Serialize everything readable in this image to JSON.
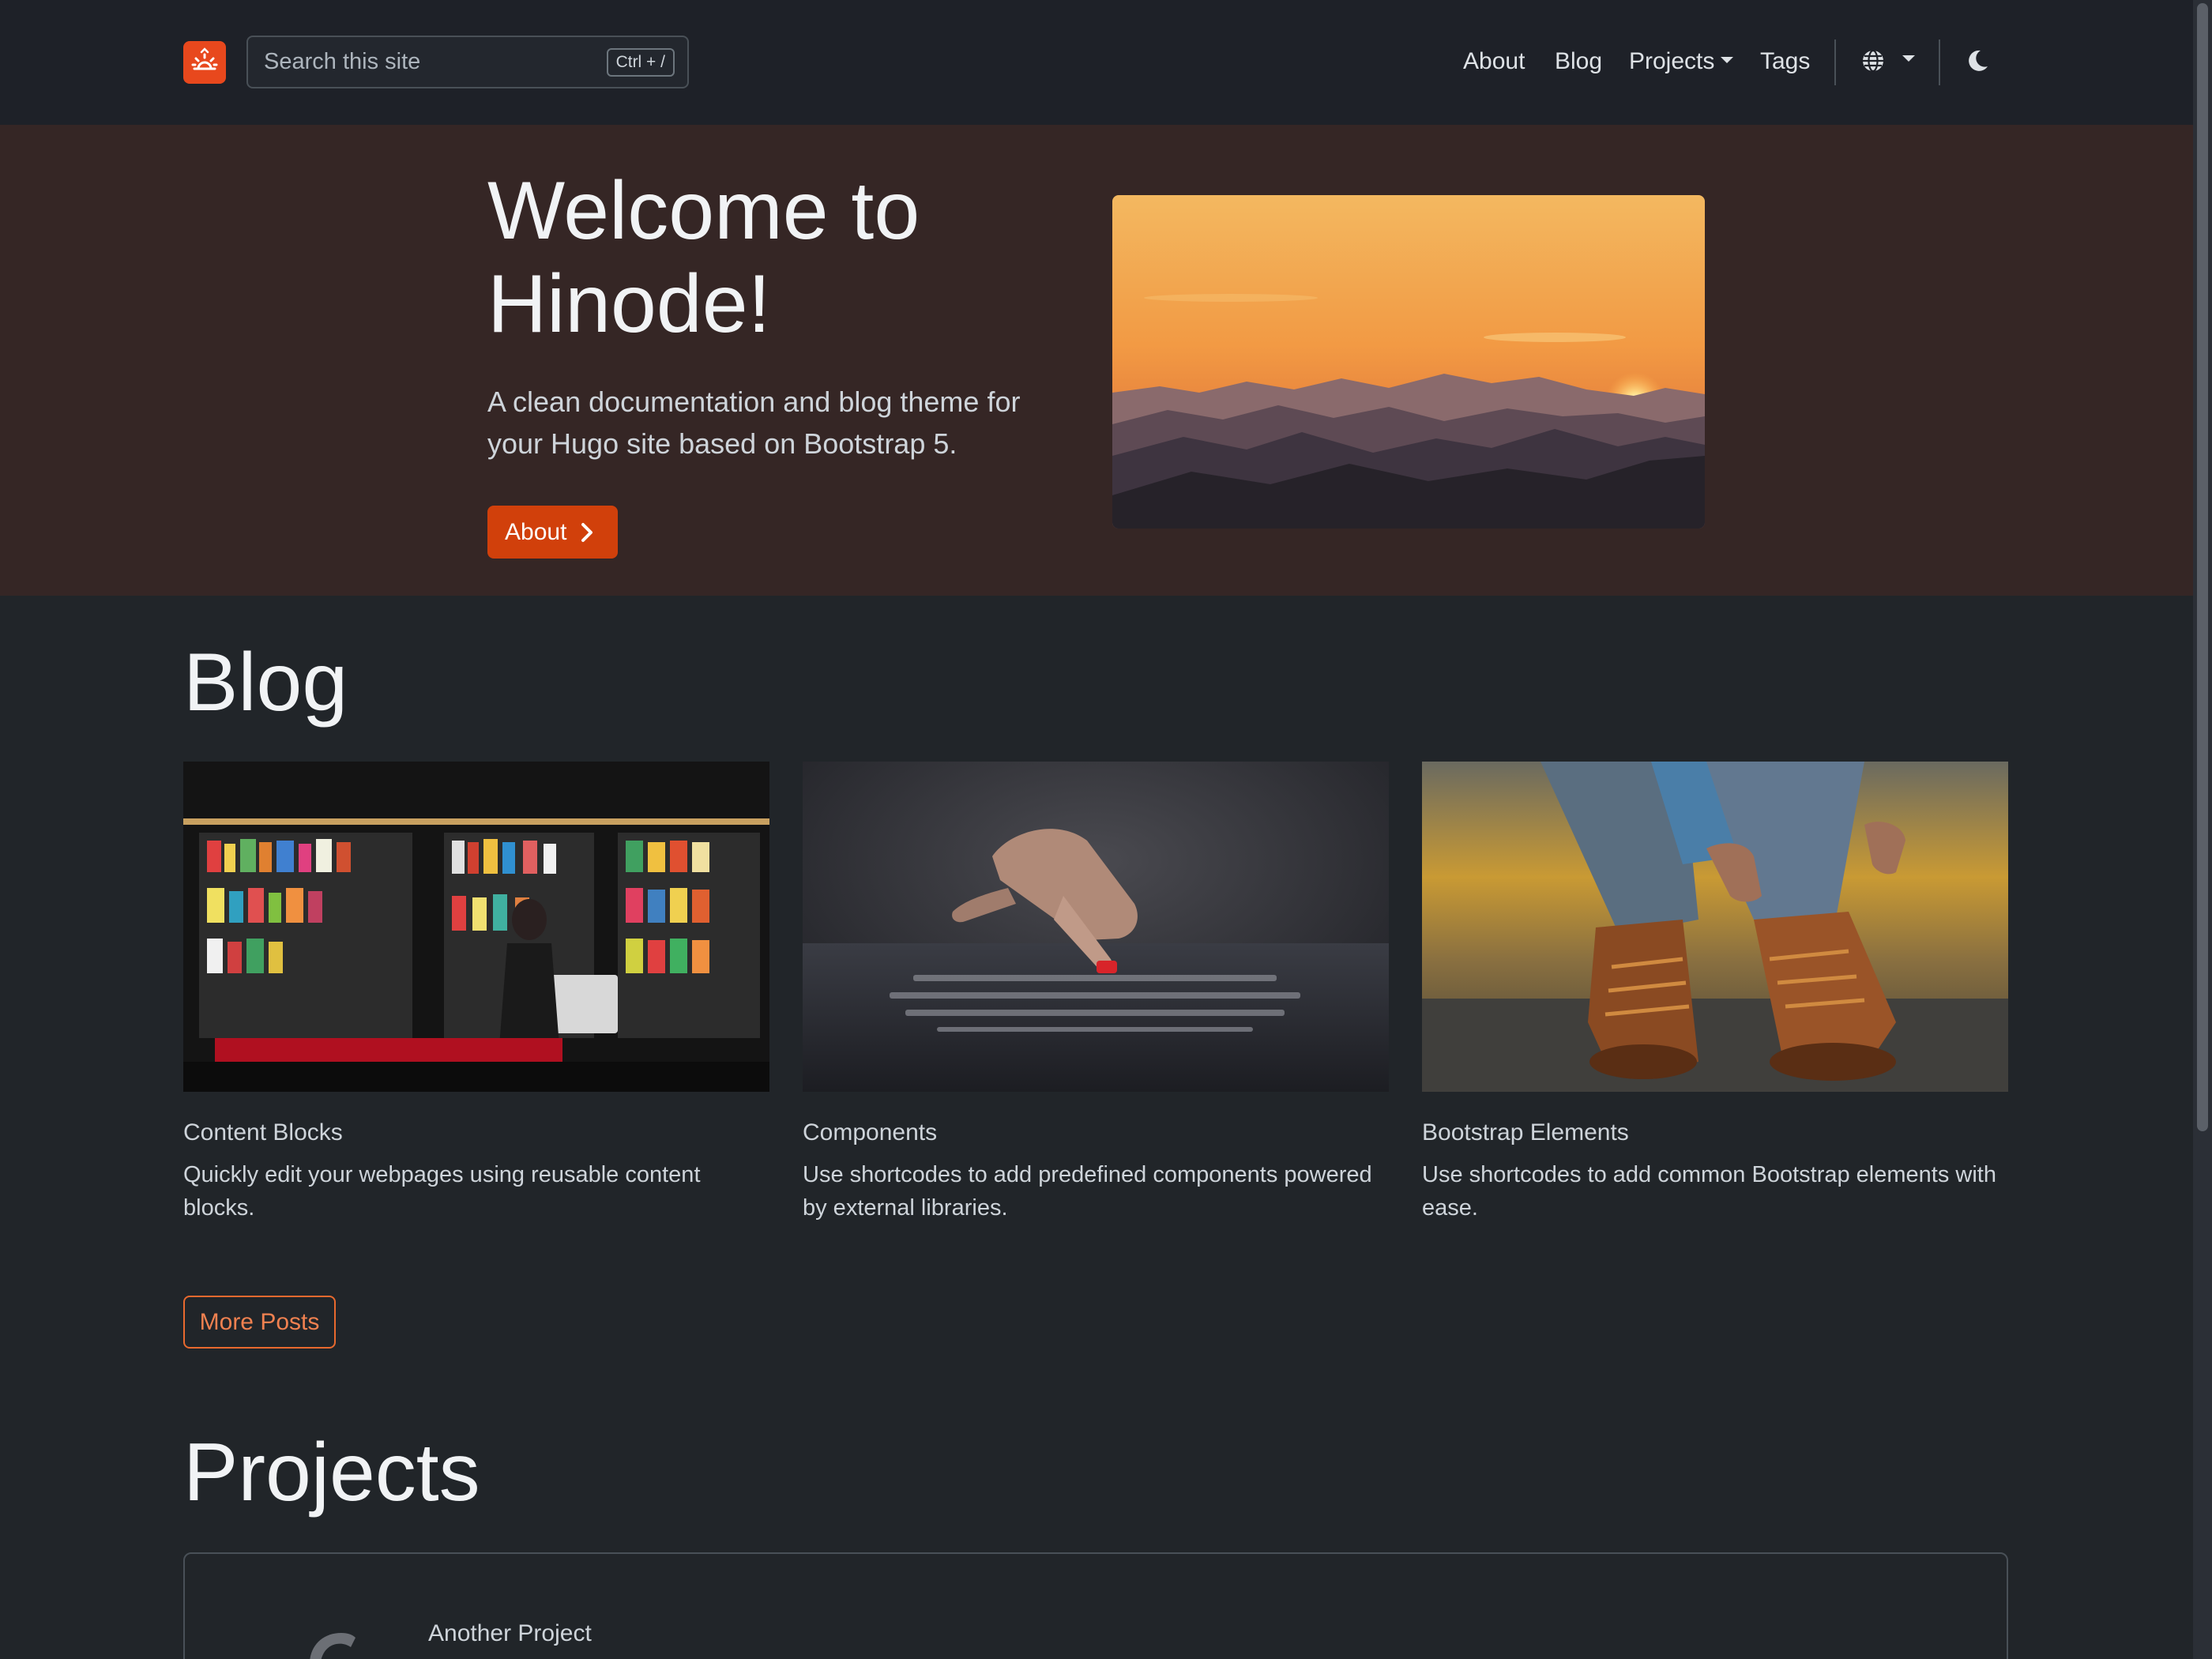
{
  "navbar": {
    "search_placeholder": "Search this site",
    "search_shortcut": "Ctrl + /",
    "links": {
      "about": "About",
      "blog": "Blog",
      "projects": "Projects",
      "tags": "Tags"
    },
    "icons": {
      "logo": "sunrise-icon",
      "language": "globe-icon",
      "theme": "moon-icon"
    }
  },
  "hero": {
    "title": "Welcome to Hinode!",
    "subtitle": "A clean documentation and blog theme for your Hugo site based on Bootstrap 5.",
    "button_label": "About"
  },
  "blog": {
    "heading": "Blog",
    "posts": [
      {
        "title": "Content Blocks",
        "text": "Quickly edit your webpages using reusable content blocks."
      },
      {
        "title": "Components",
        "text": "Use shortcodes to add predefined components powered by external libraries."
      },
      {
        "title": "Bootstrap Elements",
        "text": "Use shortcodes to add common Bootstrap elements with ease."
      }
    ],
    "more_label": "More Posts"
  },
  "projects": {
    "heading": "Projects",
    "items": [
      {
        "title": "Another Project"
      }
    ]
  },
  "colors": {
    "accent": "#e8481d",
    "background": "#212529",
    "hero_background": "#352625"
  }
}
